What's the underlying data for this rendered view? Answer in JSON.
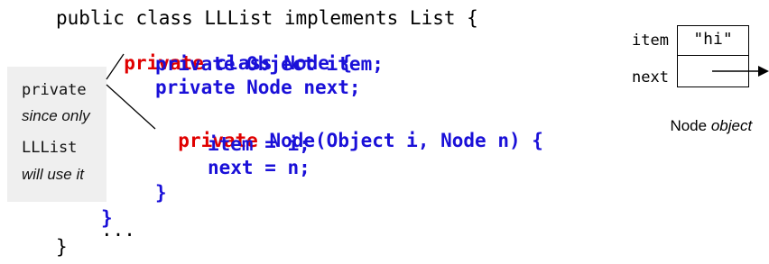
{
  "code": {
    "line1": "public class LLList implements List {",
    "line2_kw": "private",
    "line2_rest": " class Node {",
    "line3": "private Object item;",
    "line4": "private Node next;",
    "line5_kw": "private",
    "line5_rest": " Node(Object i, Node n) {",
    "line6": "item = i;",
    "line7": "next = n;",
    "line8": "}",
    "line9": "}",
    "line10": "...",
    "line11": "}"
  },
  "callout": {
    "l1": "private",
    "l2": "since only",
    "l3": "LLList",
    "l4": "will use it"
  },
  "node_diagram": {
    "item_label": "item",
    "item_value": "\"hi\"",
    "next_label": "next",
    "caption_word": "Node",
    "caption_ital": " object"
  }
}
